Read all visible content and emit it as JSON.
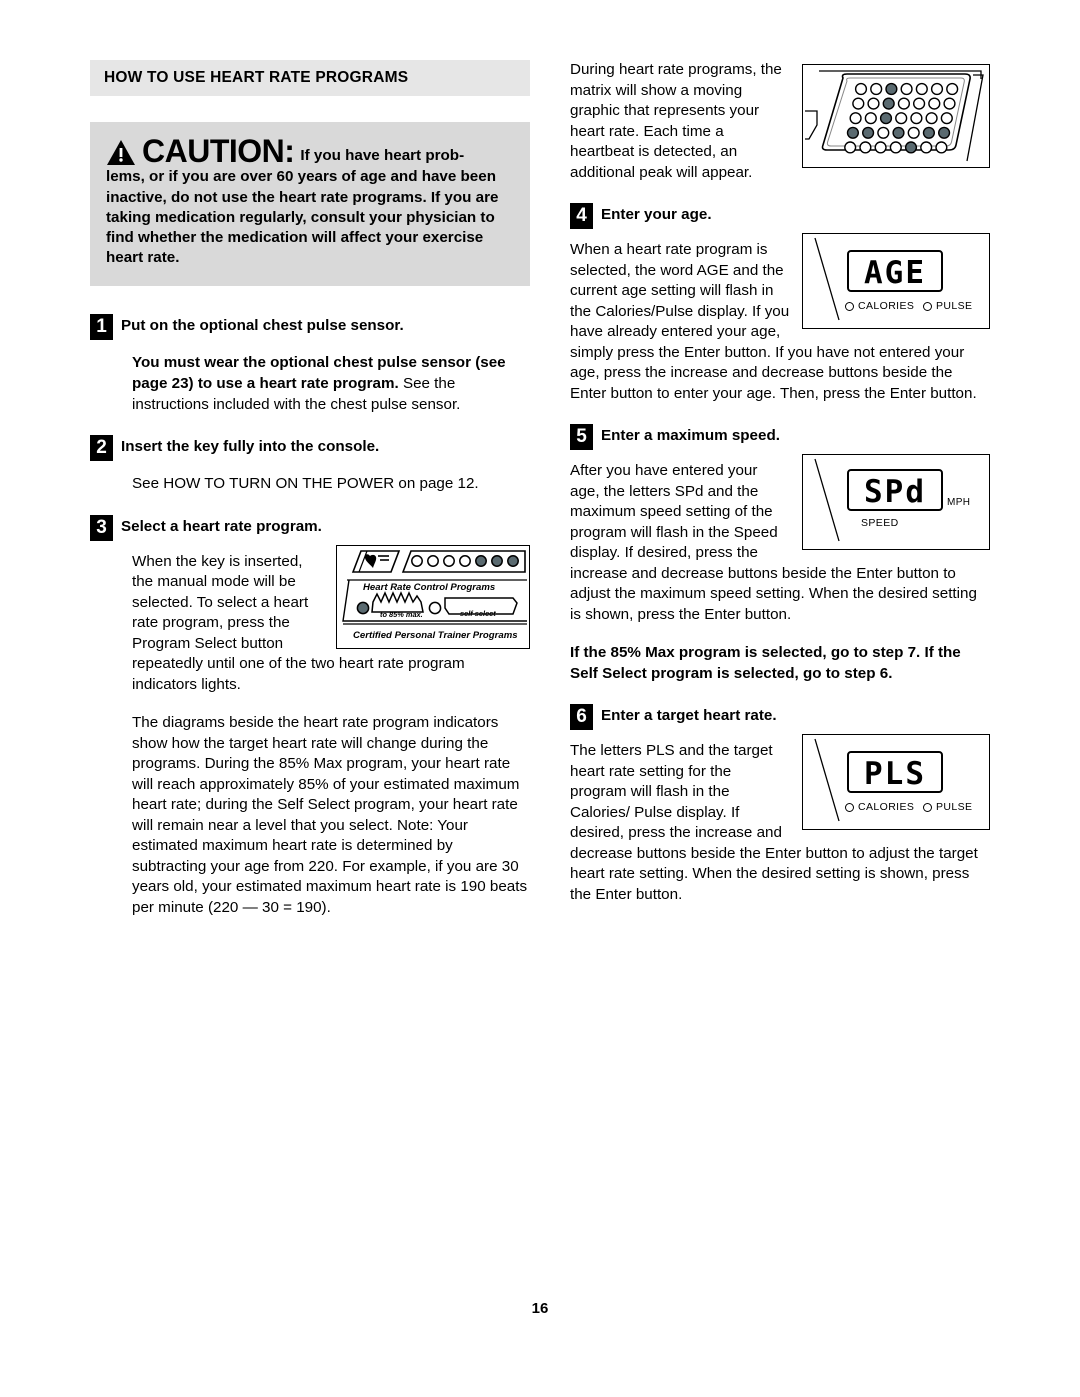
{
  "document": {
    "page_number": "16"
  },
  "section": {
    "header": "HOW TO USE HEART RATE PROGRAMS"
  },
  "caution": {
    "icon": "warning-triangle-icon",
    "word": "CAUTION:",
    "first_line": "If you have heart prob-",
    "rest": "lems, or if you are over 60 years of age and have been inactive, do not use the heart rate programs. If you are taking medication regularly, consult your physician to find whether the medication will affect your exercise heart rate."
  },
  "steps": {
    "step1": {
      "number": "1",
      "title": "Put on the optional chest pulse sensor.",
      "bold_part": "You must wear the optional chest pulse sensor (see page 23) to use a heart rate program.",
      "normal_part": " See the instructions included with the chest pulse sensor."
    },
    "step2": {
      "number": "2",
      "title": "Insert the key fully into the console.",
      "body": "See HOW TO TURN ON THE POWER on page 12."
    },
    "step3": {
      "number": "3",
      "title": "Select a heart rate program.",
      "body_wrap": "When the key is inserted, the manual mode will be selected. To select a heart rate program, press the Program Select button repeatedly until one of the two heart rate program indicators lights.",
      "body2": "The diagrams beside the heart rate program indicators show how the target heart rate will change during the programs. During the 85% Max program, your heart rate will reach approximately 85% of your estimated maximum heart rate; during the Self Select program, your heart rate will remain near a level that you select. Note: Your estimated maximum heart rate is determined by subtracting your age from 220. For example, if you are 30 years old, your estimated maximum heart rate is 190 beats per minute (220 — 30 = 190)."
    },
    "step4": {
      "number": "4",
      "title": "Enter your age.",
      "body_wrap": "When a heart rate program is selected, the word  AGE  and the current age setting will flash in the Calories/Pulse display. If you have already entered your age, simply press the Enter button. If you have not entered your age, press the increase and decrease buttons beside the Enter button to enter your age. Then, press the Enter button."
    },
    "step5": {
      "number": "5",
      "title": "Enter a maximum speed.",
      "body_wrap": "After you have entered your age, the letters  SPd  and the maximum speed setting of the program will flash in the Speed display. If desired, press the increase and decrease buttons beside the Enter button to adjust the maximum speed setting. When the desired setting is shown, press the Enter button.",
      "note_bold": "If the 85% Max program is selected, go to step 7. If the Self Select program is selected, go to step 6."
    },
    "step6": {
      "number": "6",
      "title": "Enter a target heart rate.",
      "body_wrap": "The letters  PLS  and the target heart rate setting for the program will flash in the Calories/ Pulse display. If desired, press the increase and decrease buttons beside the Enter button to adjust the target heart rate setting. When the desired setting is shown, press the Enter button."
    }
  },
  "right_intro": {
    "text": "During heart rate programs, the matrix will show a moving graphic that represents your heart rate. Each time a heartbeat is detected, an additional peak will appear."
  },
  "figures": {
    "console": {
      "name": "console-program-panel",
      "heart_icon": "heart-icon",
      "title": "Heart Rate Control Programs",
      "program_85_label": "to 85% max.",
      "program_self_label": "self select",
      "footer": "Certified Personal Trainer Programs",
      "top_circles": [
        false,
        false,
        false,
        false,
        true,
        true,
        true,
        false
      ]
    },
    "matrix": {
      "name": "dot-matrix-display",
      "rows": 5,
      "cols": 7,
      "filled": [
        [
          false,
          false,
          true,
          false,
          false,
          false,
          false
        ],
        [
          false,
          false,
          true,
          false,
          false,
          false,
          false
        ],
        [
          false,
          false,
          true,
          false,
          false,
          false,
          false
        ],
        [
          true,
          true,
          false,
          true,
          false,
          true,
          true
        ],
        [
          false,
          false,
          false,
          false,
          true,
          false,
          false
        ]
      ],
      "dot_color": "#5a6a70"
    },
    "age_display": {
      "name": "age-lcd-display",
      "value": "AGE",
      "indicator_calories": "CALORIES",
      "indicator_pulse": "PULSE"
    },
    "speed_display": {
      "name": "speed-lcd-display",
      "value": "SPd",
      "unit": "MPH",
      "label": "SPEED"
    },
    "pulse_display": {
      "name": "pulse-lcd-display",
      "value": "PLS",
      "indicator_calories": "CALORIES",
      "indicator_pulse": "PULSE"
    }
  }
}
